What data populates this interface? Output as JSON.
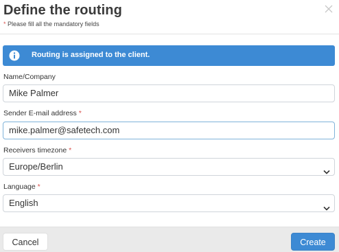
{
  "dialog": {
    "title": "Define the routing",
    "required_star": "*",
    "required_note": "Please fill all the mandatory fields",
    "close_icon": "close-icon"
  },
  "alert": {
    "icon": "info-icon",
    "message": "Routing is assigned to the client.",
    "color": "#3d8ad4"
  },
  "form": {
    "name": {
      "label": "Name/Company",
      "value": "Mike Palmer"
    },
    "email": {
      "label": "Sender E-mail address",
      "required": "*",
      "value": "mike.palmer@safetech.com"
    },
    "timezone": {
      "label": "Receivers timezone",
      "required": "*",
      "value": "Europe/Berlin"
    },
    "language": {
      "label": "Language",
      "required": "*",
      "value": "English"
    }
  },
  "footer": {
    "cancel_label": "Cancel",
    "create_label": "Create",
    "primary_color": "#3d8ad4"
  }
}
